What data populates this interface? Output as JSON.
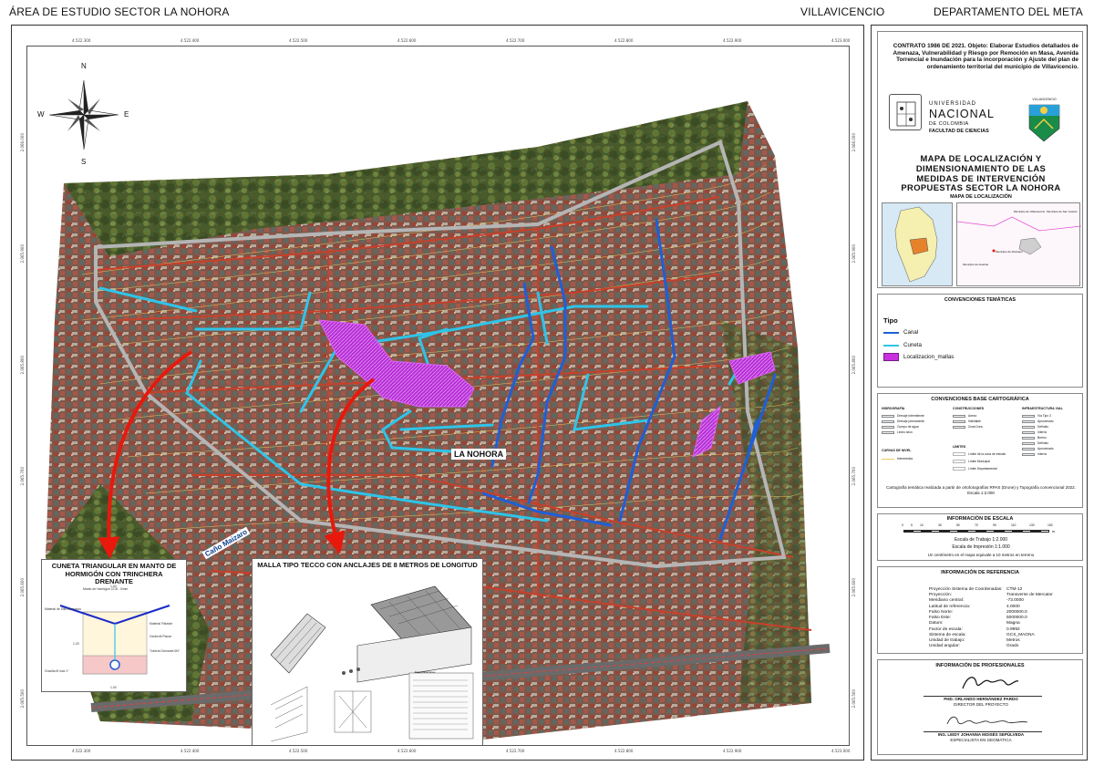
{
  "header": {
    "left": "ÁREA DE ESTUDIO SECTOR LA NOHORA",
    "middle": "VILLAVICENCIO",
    "right": "DEPARTAMENTO DEL META"
  },
  "map": {
    "compass": {
      "n": "N",
      "s": "S",
      "e": "E",
      "w": "W"
    },
    "top_coords": [
      "4.522.300",
      "4.522.400",
      "4.522.500",
      "4.522.600",
      "4.522.700",
      "4.522.800",
      "4.522.900",
      "4.523.000"
    ],
    "bottom_coords": [
      "4.522.300",
      "4.522.400",
      "4.522.500",
      "4.522.600",
      "4.522.700",
      "4.522.800",
      "4.522.900",
      "4.523.000"
    ],
    "left_coords": [
      "2.066.000",
      "2.065.900",
      "2.065.800",
      "2.065.700",
      "2.065.600",
      "2.065.500"
    ],
    "right_coords": [
      "2.066.000",
      "2.065.900",
      "2.065.800",
      "2.065.700",
      "2.065.600",
      "2.065.500"
    ],
    "area_label": "LA NOHORA",
    "creek_label": "Caño Maizaro",
    "callout_left": {
      "title": "CUNETA TRIANGULAR EN MANTO DE HORMIGÓN CON TRINCHERA DRENANTE",
      "labels": [
        "Manto de Hormigón CCB - 0/mm",
        "Material de Sitio compacto",
        "Material Filtrante",
        "Geotextil Planar",
        "Tubería Drenante Ø4\"",
        "Gravilla Ø máx 1\"",
        "1.00",
        "1.20",
        "1.00"
      ]
    },
    "callout_center": {
      "title": "MALLA TIPO TECCO CON ANCLAJES DE 8 METROS DE LONGITUD",
      "labels": [
        "Especificaciones"
      ]
    }
  },
  "panel": {
    "contract": "CONTRATO 1986 DE 2021. Objeto: Elaborar Estudios detallados de Amenaza, Vulnerabilidad y Riesgo por Remoción en Masa, Avenida Torrencial e Inundación para la incorporación y Ajuste del plan de ordenamiento territorial del municipio de Villavicencio.",
    "university": {
      "line1": "UNIVERSIDAD",
      "line2": "NACIONAL",
      "line3": "DE COLOMBIA",
      "line4": "FACULTAD DE CIENCIAS",
      "crest_label": "VILLAVICENCIO"
    },
    "map_title": "MAPA DE LOCALIZACIÓN Y DIMENSIONAMIENTO DE LAS MEDIDAS DE INTERVENCIÓN PROPUESTAS SECTOR LA NOHORA",
    "location_title": "MAPA DE LOCALIZACIÓN",
    "location_labels": [
      "Municipio de Villavicencio",
      "Municipio de San Juanito",
      "Municipio de Restrepo",
      "Municipio de Acacías"
    ],
    "thematic_title": "CONVENCIONES TEMÁTICAS",
    "tipo_title": "Tipo",
    "tipo_items": [
      {
        "label": "Canal",
        "color": "#1f5fd6"
      },
      {
        "label": "Cuneta",
        "color": "#2fc4e8"
      },
      {
        "label": "Localizacion_mallas",
        "color": "#c930e0"
      }
    ],
    "base_title": "CONVENCIONES BASE CARTOGRÁFICA",
    "base_cols": [
      {
        "title": "HIDROGRAFÍA",
        "items": [
          "Drenaje intermitente",
          "Drenaje permanente",
          "Cuerpo de agua",
          "Lecho seco"
        ]
      },
      {
        "title": "CONSTRUCCIONES",
        "items": [
          "Anexo",
          "Habitable",
          "Zona Dura"
        ]
      },
      {
        "title": "INFRAESTRUCTURA VIAL",
        "items": [
          "Vía Tipo 3",
          "Aproximado",
          "Definido",
          "Interno",
          "Bermo",
          "Definido",
          "Aproximado",
          "Interno"
        ]
      }
    ],
    "curvas_title": "CURVAS DE NIVEL",
    "curvas_item": "Intermedia",
    "limites_title": "LÍMITES",
    "limites_items": [
      "Límite de la zona de estudio",
      "Límite Municipal",
      "Límite Departamental"
    ],
    "carto_note": "Cartografía temática realizada a partir de ortofotografías RPAS (Drone) y Topografía convencional 2022. Escala 1:2.000",
    "scale_title": "INFORMACIÓN DE ESCALA",
    "scale_ticks": [
      "0",
      "5",
      "10",
      "20",
      "30",
      "40",
      "50",
      "60",
      "70",
      "80",
      "90",
      "100",
      "110",
      "120",
      "130",
      "140",
      "150"
    ],
    "scale_unit": "m",
    "scale_work": "Escala de Trabajo 1:2.000",
    "scale_print": "Escala de Impresión 1:1.000",
    "scale_note": "Un centímetro en el mapa equivale a 10 metros en terreno",
    "ref_title": "INFORMACIÓN DE REFERENCIA",
    "ref_rows": [
      [
        "Proyección Sistema de Coordenadas:",
        "CTM-12"
      ],
      [
        "Proyección:",
        "Transverse de Mercator"
      ],
      [
        "Meridiano central:",
        "-73.0000"
      ],
      [
        "Latitud de referencia:",
        "4.0000"
      ],
      [
        "Falso Norte:",
        "2000000.0"
      ],
      [
        "Falso Este:",
        "5000000.0"
      ],
      [
        "Datum:",
        "Magna"
      ],
      [
        "Factor de escala:",
        "0.9992"
      ],
      [
        "Sistema de escala:",
        "GCS_MAGNA"
      ],
      [
        "Unidad de trabajo:",
        "Metros"
      ],
      [
        "Unidad angular:",
        "Grado"
      ]
    ],
    "prof_title": "INFORMACIÓN DE PROFESIONALES",
    "signer1_name": "PHD. ORLANDO HERNÁNDEZ PARDO",
    "signer1_role": "DIRECTOR DEL PROYECTO",
    "signer2_name": "ING. LEIDY JOHANNA MOISÉS SEPÚLVEDA",
    "signer2_role": "ESPECIALISTA EN GEOMÁTICA"
  },
  "colors": {
    "canal": "#1f5fd6",
    "cuneta": "#2fc4e8",
    "mallas": "#c930e0",
    "arrow": "#e8180c",
    "boundary": "#b5b5b5",
    "road": "#c8402a"
  }
}
